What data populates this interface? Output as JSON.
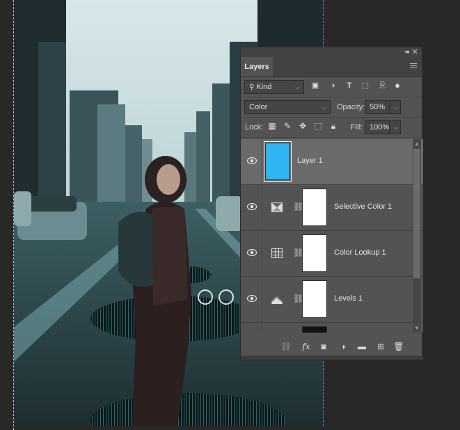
{
  "panel": {
    "tab_label": "Layers",
    "filter_kind_label": "Kind",
    "blend_mode": "Color",
    "opacity_label": "Opacity:",
    "opacity_value": "50%",
    "lock_label": "Lock:",
    "fill_label": "Fill:",
    "fill_value": "100%"
  },
  "layers": [
    {
      "name": "Layer 1",
      "selected": true,
      "thumb_color": "#2fb6f2"
    },
    {
      "name": "Selective Color 1",
      "selected": false,
      "icon": "selective-color-icon"
    },
    {
      "name": "Color Lookup 1",
      "selected": false,
      "icon": "color-lookup-icon"
    },
    {
      "name": "Levels 1",
      "selected": false,
      "icon": "levels-icon"
    }
  ],
  "colors": {
    "accent": "#2fb6f2",
    "panel_bg": "#535353",
    "selected_row": "#6a6a6a"
  }
}
